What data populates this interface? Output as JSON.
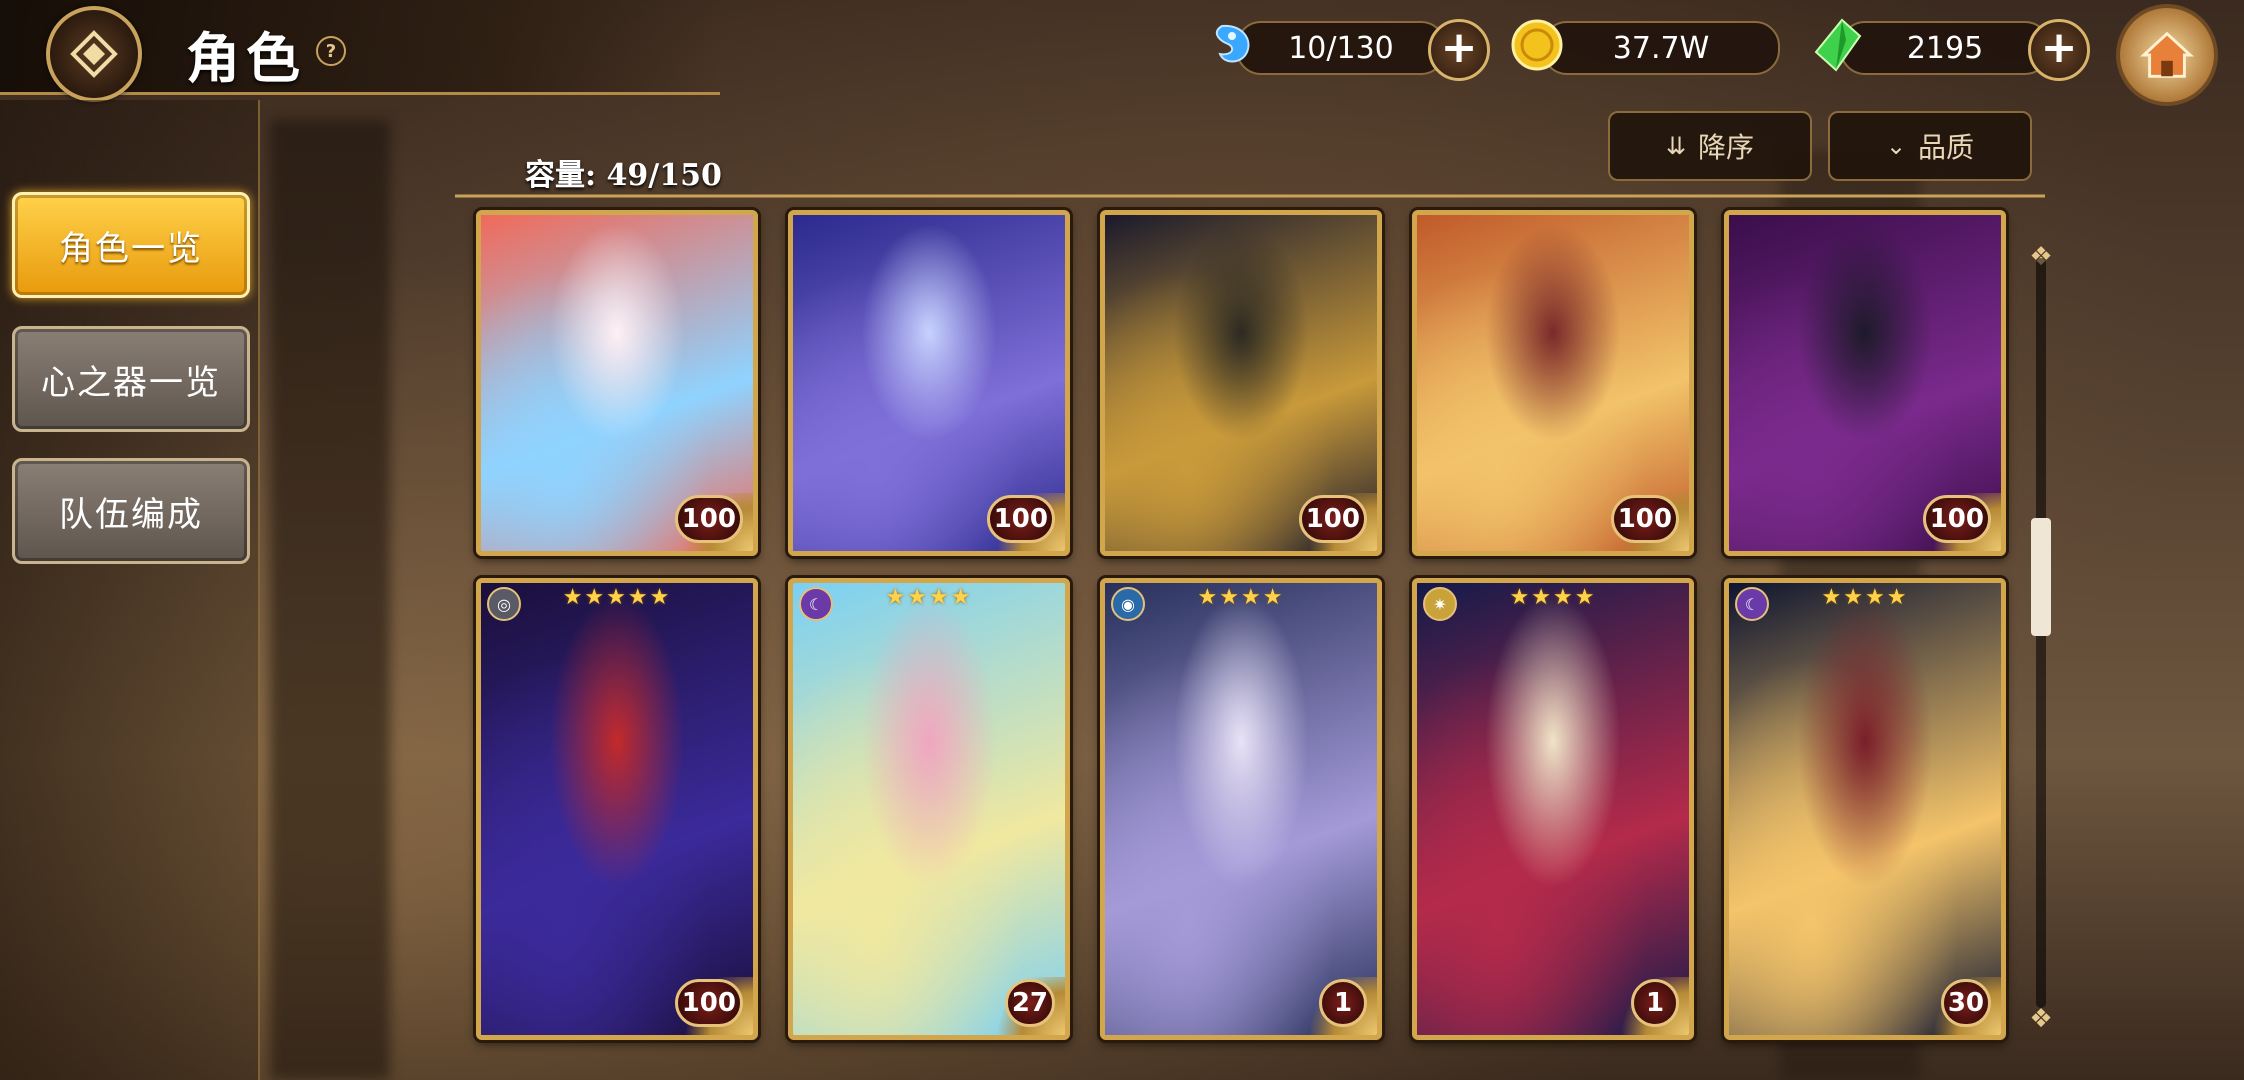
{
  "header": {
    "title": "角色",
    "help": "?"
  },
  "currencies": [
    {
      "name": "stamina",
      "icon": "water-drop-icon",
      "value": "10/130",
      "color": "#3aa8ff"
    },
    {
      "name": "gold",
      "icon": "gold-coin-icon",
      "value": "37.7W",
      "color": "#f4c21c"
    },
    {
      "name": "gems",
      "icon": "green-crystal-icon",
      "value": "2195",
      "color": "#3fd14b"
    }
  ],
  "toolbar": {
    "sort_label": "降序",
    "filter_label": "品质"
  },
  "capacity": "容量: 49/150",
  "sidebar": {
    "items": [
      {
        "label": "角色一览",
        "active": true
      },
      {
        "label": "心之器一览",
        "active": false
      },
      {
        "label": "队伍编成",
        "active": false
      }
    ]
  },
  "cards": [
    {
      "level": "100",
      "stars": "",
      "palette": [
        "#f06a5a",
        "#8fd3ff",
        "#fff0f4"
      ]
    },
    {
      "level": "100",
      "stars": "",
      "palette": [
        "#2b2a8c",
        "#7f6fd8",
        "#c7d2ff"
      ]
    },
    {
      "level": "100",
      "stars": "",
      "palette": [
        "#1b1a2c",
        "#c99a3a",
        "#2c2a22"
      ]
    },
    {
      "level": "100",
      "stars": "",
      "palette": [
        "#c05a2a",
        "#f2c36a",
        "#7a2a2a"
      ]
    },
    {
      "level": "100",
      "stars": "",
      "palette": [
        "#3a0e4a",
        "#7a2a8c",
        "#1e1a2a"
      ]
    },
    {
      "level": "100",
      "stars": "★★★★★",
      "palette": [
        "#1a0f3a",
        "#3b2a9a",
        "#c22a2a"
      ]
    },
    {
      "level": "27",
      "stars": "★★★★",
      "palette": [
        "#7ad0f4",
        "#f0e8a0",
        "#f0a6c0"
      ]
    },
    {
      "level": "1",
      "stars": "★★★★",
      "palette": [
        "#27305a",
        "#a49ad8",
        "#e8e2f6"
      ]
    },
    {
      "level": "1",
      "stars": "★★★★",
      "palette": [
        "#141a4a",
        "#b42a4a",
        "#f0e4c8"
      ]
    },
    {
      "level": "30",
      "stars": "★★★★",
      "palette": [
        "#0e1530",
        "#f4c46a",
        "#7a1e2a"
      ]
    }
  ]
}
